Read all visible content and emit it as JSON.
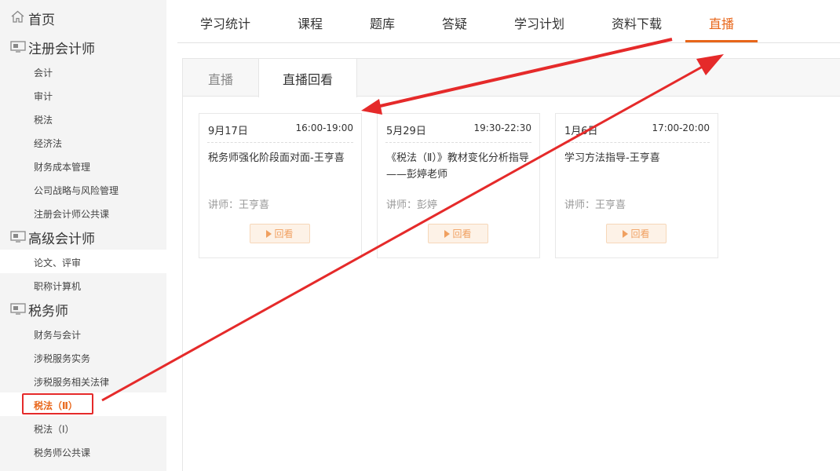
{
  "sidebar": {
    "home": "首页",
    "categories": [
      {
        "label": "注册会计师",
        "items": [
          "会计",
          "审计",
          "税法",
          "经济法",
          "财务成本管理",
          "公司战略与风险管理",
          "注册会计师公共课"
        ]
      },
      {
        "label": "高级会计师",
        "items": [
          "论文、评审",
          "职称计算机"
        ]
      },
      {
        "label": "税务师",
        "items": [
          "财务与会计",
          "涉税服务实务",
          "涉税服务相关法律",
          "税法（Ⅱ）",
          "税法（Ⅰ）",
          "税务师公共课"
        ]
      }
    ]
  },
  "topnav": {
    "tabs": [
      "学习统计",
      "课程",
      "题库",
      "答疑",
      "学习计划",
      "资料下载",
      "直播"
    ],
    "active": "直播"
  },
  "subtabs": [
    "直播",
    "直播回看"
  ],
  "cards": [
    {
      "date": "9月17日",
      "time": "16:00-19:00",
      "title": "税务师强化阶段面对面-王亨喜",
      "teacher": "讲师：王亨喜",
      "button": "回看"
    },
    {
      "date": "5月29日",
      "time": "19:30-22:30",
      "title": "《税法（Ⅱ）》教材变化分析指导——彭婷老师",
      "teacher": "讲师：彭婷",
      "button": "回看"
    },
    {
      "date": "1月6日",
      "time": "17:00-20:00",
      "title": "学习方法指导-王亨喜",
      "teacher": "讲师：王亨喜",
      "button": "回看"
    }
  ],
  "colors": {
    "accent": "#e8661a",
    "annotation": "#e52a2a"
  }
}
